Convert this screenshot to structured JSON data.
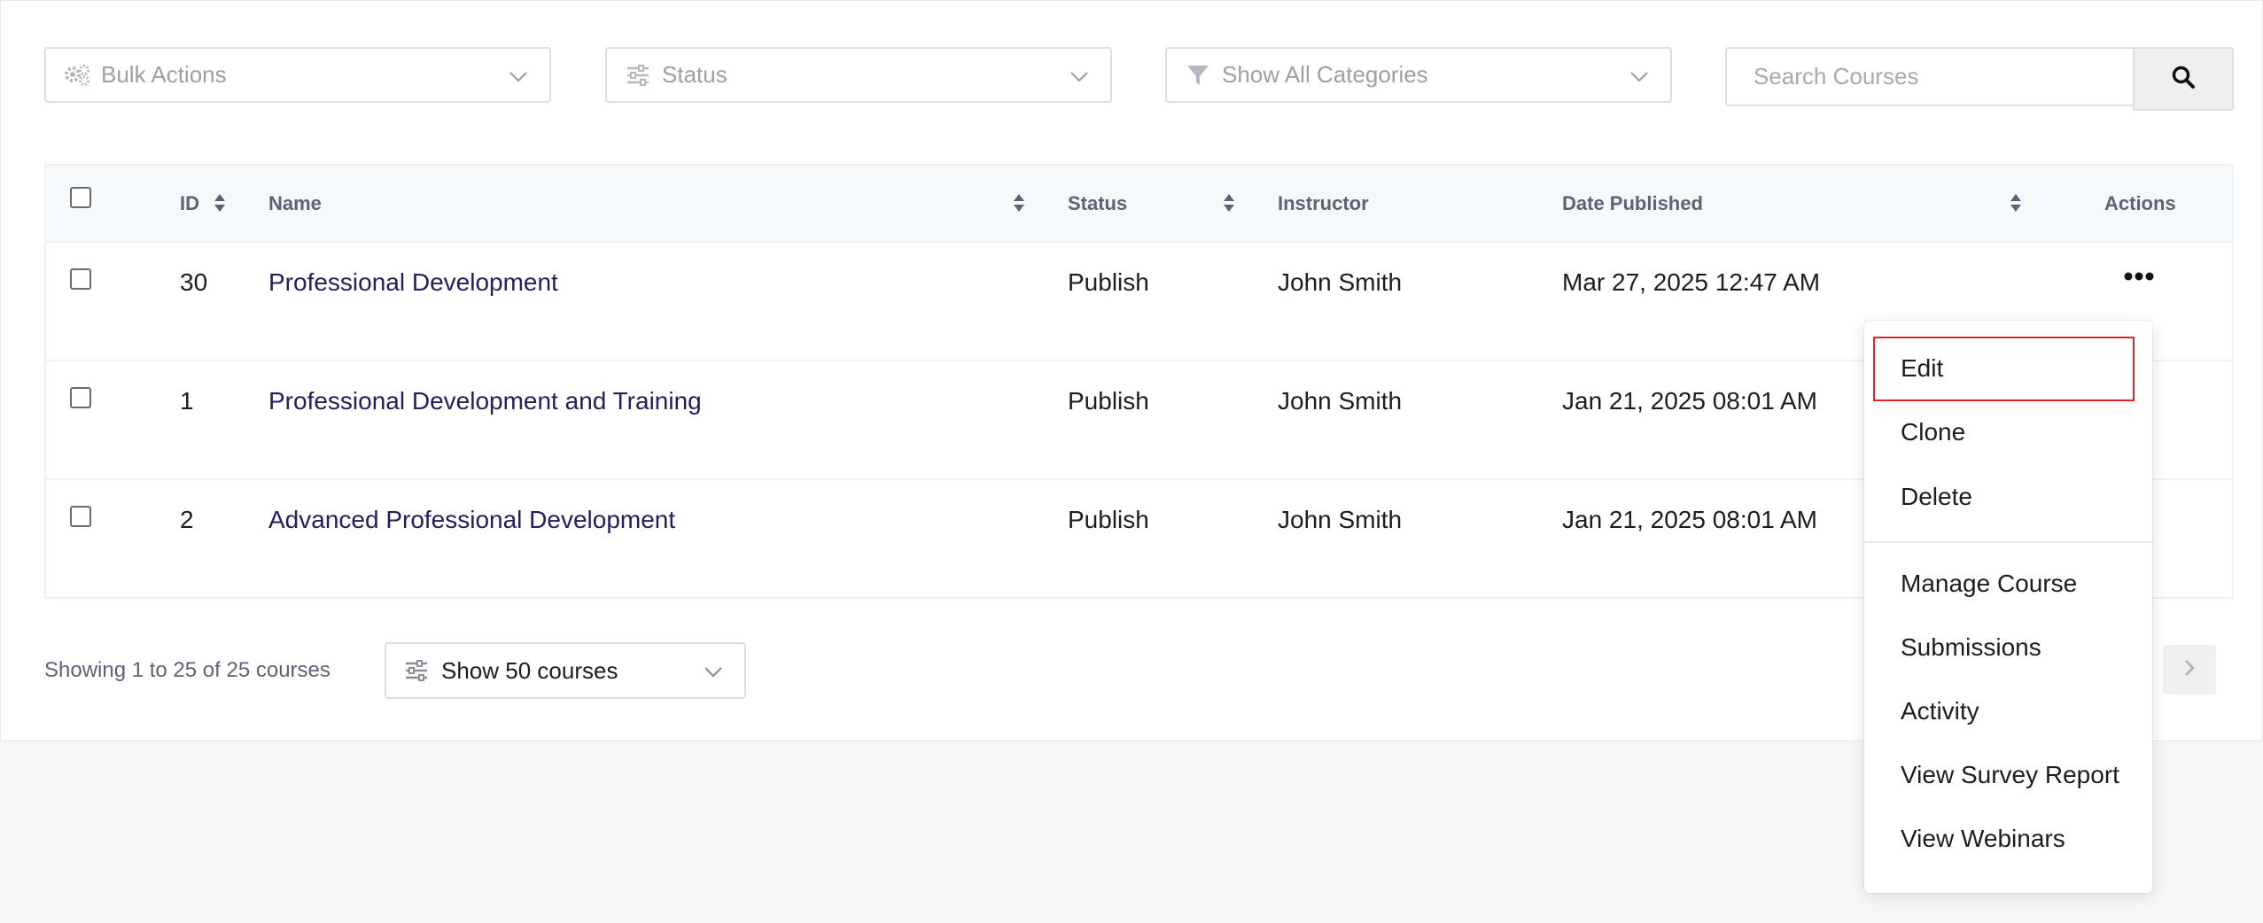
{
  "filters": {
    "bulk_actions": "Bulk Actions",
    "status": "Status",
    "categories": "Show All Categories",
    "search_placeholder": "Search Courses"
  },
  "table": {
    "columns": {
      "id": "ID",
      "name": "Name",
      "status": "Status",
      "instructor": "Instructor",
      "date_published": "Date Published",
      "actions": "Actions"
    },
    "rows": [
      {
        "id": "30",
        "name": "Professional Development",
        "status": "Publish",
        "instructor": "John Smith",
        "date": "Mar 27, 2025 12:47 AM"
      },
      {
        "id": "1",
        "name": "Professional Development and Training",
        "status": "Publish",
        "instructor": "John Smith",
        "date": "Jan 21, 2025 08:01 AM"
      },
      {
        "id": "2",
        "name": "Advanced Professional Development",
        "status": "Publish",
        "instructor": "John Smith",
        "date": "Jan 21, 2025 08:01 AM"
      }
    ]
  },
  "footer": {
    "showing": "Showing 1 to 25 of 25 courses",
    "per_page": "Show 50 courses"
  },
  "menu": {
    "edit": "Edit",
    "clone": "Clone",
    "delete": "Delete",
    "manage_course": "Manage Course",
    "submissions": "Submissions",
    "activity": "Activity",
    "view_survey_report": "View Survey Report",
    "view_webinars": "View Webinars"
  },
  "colors": {
    "link": "#2b1a5c",
    "highlight": "#d9262b",
    "header_bg": "#f6f9fc"
  },
  "icons": [
    "gears-icon",
    "sliders-icon",
    "filter-icon",
    "search-icon",
    "chevron-down-icon",
    "sort-icon",
    "more-horizontal-icon",
    "chevron-right-icon"
  ]
}
